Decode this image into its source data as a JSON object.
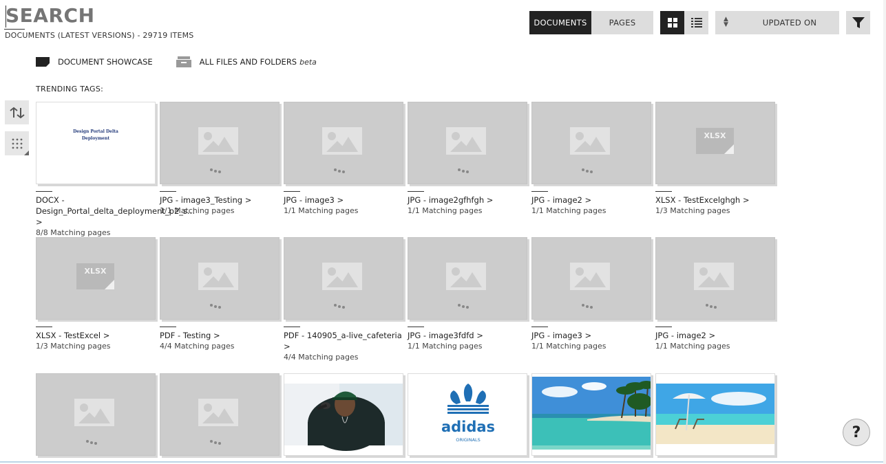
{
  "search": {
    "placeholder": "SEARCH",
    "value": ""
  },
  "doc_count": "DOCUMENTS (LATEST VERSIONS) - 29719 ITEMS",
  "toolbar": {
    "documents_label": "DOCUMENTS",
    "pages_label": "PAGES",
    "sort_label": "UPDATED ON"
  },
  "nav": {
    "showcase_label": "DOCUMENT SHOWCASE",
    "all_files_label": "ALL FILES AND FOLDERS",
    "beta_label": "beta"
  },
  "trending_label": "TRENDING TAGS:",
  "docx_preview": {
    "line1": "Design Portal Delta",
    "line2": "Deployment"
  },
  "tiles": [
    {
      "type": "DOCX",
      "name": "Design_Portal_delta_deployment_p2_s...",
      "pages": "8/8 Matching pages",
      "thumb": "docx"
    },
    {
      "type": "JPG",
      "name": "image3_Testing",
      "pages": "1/1 Matching pages",
      "thumb": "image"
    },
    {
      "type": "JPG",
      "name": "image3",
      "pages": "1/1 Matching pages",
      "thumb": "image"
    },
    {
      "type": "JPG",
      "name": "image2gfhfgh",
      "pages": "1/1 Matching pages",
      "thumb": "image"
    },
    {
      "type": "JPG",
      "name": "image2",
      "pages": "1/1 Matching pages",
      "thumb": "image"
    },
    {
      "type": "XLSX",
      "name": "TestExcelghgh",
      "pages": "1/3 Matching pages",
      "thumb": "xlsx"
    },
    {
      "type": "XLSX",
      "name": "TestExcel",
      "pages": "1/3 Matching pages",
      "thumb": "xlsx"
    },
    {
      "type": "PDF",
      "name": "Testing",
      "pages": "4/4 Matching pages",
      "thumb": "image"
    },
    {
      "type": "PDF",
      "name": "140905_a-live_cafeteria",
      "pages": "4/4 Matching pages",
      "thumb": "image"
    },
    {
      "type": "JPG",
      "name": "image3fdfd",
      "pages": "1/1 Matching pages",
      "thumb": "image"
    },
    {
      "type": "JPG",
      "name": "image3",
      "pages": "1/1 Matching pages",
      "thumb": "image"
    },
    {
      "type": "JPG",
      "name": "image2",
      "pages": "1/1 Matching pages",
      "thumb": "image"
    }
  ],
  "xlsx_label": "XLSX",
  "adidas": {
    "brand": "adidas",
    "sub": "ORIGINALS"
  },
  "help_label": "?"
}
